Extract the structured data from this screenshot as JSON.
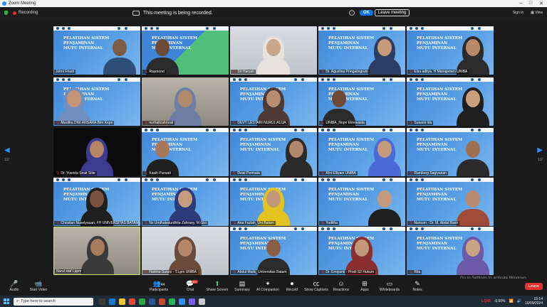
{
  "window": {
    "title": "Zoom Meeting"
  },
  "status": {
    "recording_label": "Recording"
  },
  "notice": {
    "text": "This meeting is being recorded.",
    "ok_label": "OK",
    "leave_label": "Leave meeting"
  },
  "top_right": {
    "signin": "Sign in",
    "view": "View"
  },
  "pager": {
    "left": "1/2",
    "right": "1/2"
  },
  "slide_text": "PELATIHAN SISTEM\nPENJAMINAN\nMUTU INTERNAL",
  "participants": [
    {
      "name": "Johni Friadi",
      "muted": false
    },
    {
      "name": "Raymond",
      "muted": true
    },
    {
      "name": "Sri Haryati",
      "muted": true
    },
    {
      "name": "Dr. Agustina Pringatingrum",
      "muted": true
    },
    {
      "name": "Elsa aditya. H Manajemen UNIBA",
      "muted": true
    },
    {
      "name": "Mustika DWI ANSARA Btm Kepri",
      "muted": true
    },
    {
      "name": "nurhafizahrizati",
      "muted": true
    },
    {
      "name": "DEVY LESTARI NURUL ALIJA",
      "muted": true
    },
    {
      "name": "UNIBA_Nopri Elinovasta",
      "muted": true
    },
    {
      "name": "Susanti Ida",
      "muted": true
    },
    {
      "name": "Dr. Yusrida Sirait Stiie",
      "muted": true
    },
    {
      "name": "Kasih Purwati",
      "muted": true
    },
    {
      "name": "Dewi Permata",
      "muted": true
    },
    {
      "name": "Afni Elliyani UNIBA",
      "muted": true
    },
    {
      "name": "Ramberg Sagiyanan",
      "muted": true
    },
    {
      "name": "Christian Nusetyasari, FH UNIVERSITAS BATAM",
      "muted": true
    },
    {
      "name": "Ns Undhakaturdhita Zahrany, M.Gizi",
      "muted": true
    },
    {
      "name": "Ana Fazlah_Uni Batam",
      "muted": true
    },
    {
      "name": "Yuditha",
      "muted": true
    },
    {
      "name": "Narsum - Dr. M. Abdul Basir",
      "muted": true
    },
    {
      "name": "Nurul staf Lppm",
      "muted": false
    },
    {
      "name": "Harima Surani - T.Lpm UNIBA",
      "muted": true
    },
    {
      "name": "Abdul Malik_Universitas Batam",
      "muted": true
    },
    {
      "name": "Dr. Emiyanti - Prodi S2 Hukum",
      "muted": true
    },
    {
      "name": "Rita",
      "muted": true
    }
  ],
  "toolbar": {
    "audio": "Audio",
    "video": "Start Video",
    "participants": "Participants",
    "participants_count": "44",
    "chat": "Chat",
    "chat_badge": "99+",
    "share": "Share Screen",
    "summary": "Summary",
    "ai": "AI Companion",
    "record": "Record",
    "captions": "Show Captions",
    "reactions": "Reactions",
    "apps": "Apps",
    "whiteboards": "Whiteboards",
    "notes": "Notes",
    "leave": "Leave"
  },
  "watermark": "Go to Settings to activate Windows.",
  "taskbar": {
    "search_placeholder": "Type here to search",
    "stock": "LQ45",
    "stock_change": "-0,60%",
    "time": "15:14",
    "date": "10/09/2024"
  }
}
